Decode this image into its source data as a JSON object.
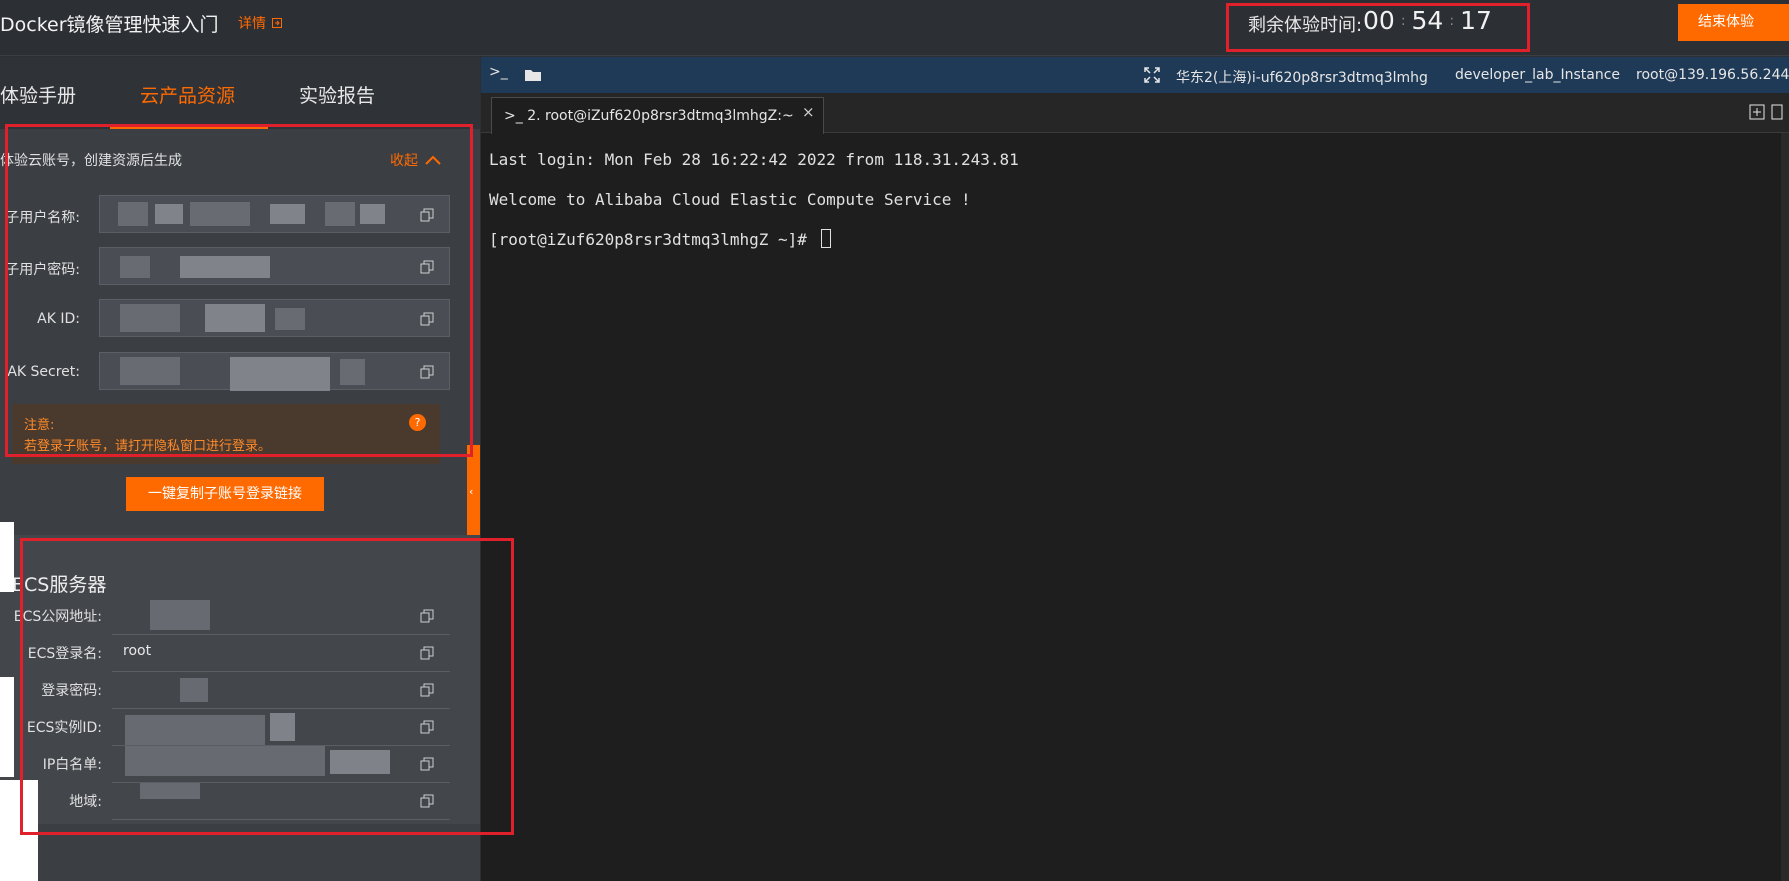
{
  "header": {
    "title": "Docker镜像管理快速入门",
    "detail_label": "详情",
    "timer_label": "剩余体验时间:",
    "timer": {
      "hours": "00",
      "minutes": "54",
      "seconds": "17"
    },
    "end_button": "结束体验"
  },
  "left_tabs": [
    "体验手册",
    "云产品资源",
    "实验报告"
  ],
  "account": {
    "title": "体验云账号，创建资源后生成",
    "collapse_label": "收起",
    "fields": [
      {
        "label": "子用户名称:"
      },
      {
        "label": "子用户密码:"
      },
      {
        "label": "AK ID:"
      },
      {
        "label": "AK Secret:"
      }
    ],
    "notice_title": "注意:",
    "notice_text": "若登录子账号，请打开隐私窗口进行登录。",
    "copy_login_button": "一键复制子账号登录链接"
  },
  "ecs": {
    "title": "ECS服务器",
    "rows": [
      {
        "label": "ECS公网地址:",
        "value": ""
      },
      {
        "label": "ECS登录名:",
        "value": "root"
      },
      {
        "label": "登录密码:",
        "value": ""
      },
      {
        "label": "ECS实例ID:",
        "value": ""
      },
      {
        "label": "IP白名单:",
        "value": ""
      },
      {
        "label": "地域:",
        "value": ""
      }
    ]
  },
  "terminal": {
    "region": "华东2(上海)i-uf620p8rsr3dtmq3lmhg",
    "instance_name": "developer_lab_Instance",
    "user_host": "root@139.196.56.244",
    "tab_label": "2. root@iZuf620p8rsr3dtmq3lmhgZ:~",
    "lines": [
      "Last login: Mon Feb 28 16:22:42 2022 from 118.31.243.81",
      "Welcome to Alibaba Cloud Elastic Compute Service !",
      "[root@iZuf620p8rsr3dtmq3lmhgZ ~]# "
    ]
  },
  "colors": {
    "accent": "#ff6a00",
    "annotation": "#e0202b",
    "terminal_bg": "#1e1e1e",
    "toolbar": "#1f3a57"
  }
}
